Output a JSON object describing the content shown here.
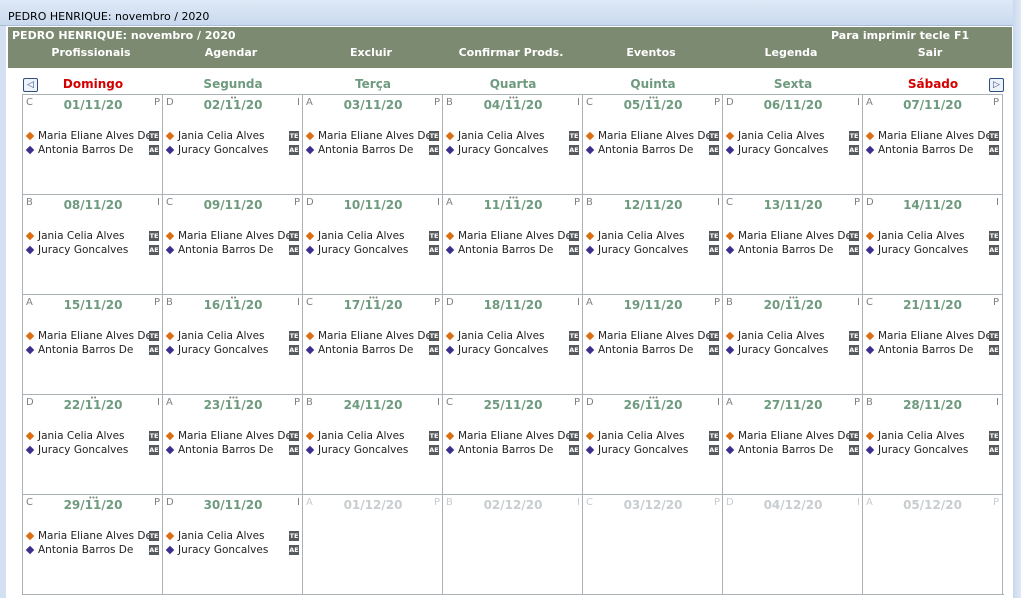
{
  "window": {
    "title": "PEDRO HENRIQUE: novembro / 2020"
  },
  "toolbar": {
    "title": "PEDRO HENRIQUE: novembro / 2020",
    "print_hint": "Para imprimir tecle F1",
    "menu": [
      "Profissionais",
      "Agendar",
      "Excluir",
      "Confirmar Prods.",
      "Eventos",
      "Legenda",
      "Sair"
    ]
  },
  "nav": {
    "prev_icon": "prev-month-icon",
    "next_icon": "next-month-icon"
  },
  "colors": {
    "toolbar_bg": "#7d8a72",
    "weekday": "#6e9a7e",
    "weekend": "#d40000",
    "marker_orange": "#d96f12",
    "marker_blue": "#3a2f8f"
  },
  "weekdays": [
    "Domingo",
    "Segunda",
    "Terça",
    "Quarta",
    "Quinta",
    "Sexta",
    "Sábado"
  ],
  "weeks": [
    [
      {
        "date": "01/11/20",
        "left": "C",
        "right": "P",
        "dots": "",
        "entries": [
          {
            "name": "Maria Eliane Alves De",
            "badge": "TE",
            "color": "orange"
          },
          {
            "name": "Antonia Barros De",
            "badge": "AE",
            "color": "blue"
          }
        ]
      },
      {
        "date": "02/11/20",
        "left": "D",
        "right": "I",
        "dots": "••",
        "entries": [
          {
            "name": "Jania Celia Alves",
            "badge": "TE",
            "color": "orange"
          },
          {
            "name": "Juracy Goncalves",
            "badge": "AE",
            "color": "blue"
          }
        ]
      },
      {
        "date": "03/11/20",
        "left": "A",
        "right": "P",
        "dots": "",
        "entries": [
          {
            "name": "Maria Eliane Alves De",
            "badge": "TE",
            "color": "orange"
          },
          {
            "name": "Antonia Barros De",
            "badge": "AE",
            "color": "blue"
          }
        ]
      },
      {
        "date": "04/11/20",
        "left": "B",
        "right": "I",
        "dots": "•••",
        "entries": [
          {
            "name": "Jania Celia Alves",
            "badge": "TE",
            "color": "orange"
          },
          {
            "name": "Juracy Goncalves",
            "badge": "AE",
            "color": "blue"
          }
        ]
      },
      {
        "date": "05/11/20",
        "left": "C",
        "right": "P",
        "dots": "•••",
        "entries": [
          {
            "name": "Maria Eliane Alves De",
            "badge": "TE",
            "color": "orange"
          },
          {
            "name": "Antonia Barros De",
            "badge": "AE",
            "color": "blue"
          }
        ]
      },
      {
        "date": "06/11/20",
        "left": "D",
        "right": "I",
        "dots": "",
        "entries": [
          {
            "name": "Jania Celia Alves",
            "badge": "TE",
            "color": "orange"
          },
          {
            "name": "Juracy Goncalves",
            "badge": "AE",
            "color": "blue"
          }
        ]
      },
      {
        "date": "07/11/20",
        "left": "A",
        "right": "P",
        "dots": "",
        "entries": [
          {
            "name": "Maria Eliane Alves De",
            "badge": "TE",
            "color": "orange"
          },
          {
            "name": "Antonia Barros De",
            "badge": "AE",
            "color": "blue"
          }
        ]
      }
    ],
    [
      {
        "date": "08/11/20",
        "left": "B",
        "right": "I",
        "dots": "",
        "entries": [
          {
            "name": "Jania Celia Alves",
            "badge": "TE",
            "color": "orange"
          },
          {
            "name": "Juracy Goncalves",
            "badge": "AE",
            "color": "blue"
          }
        ]
      },
      {
        "date": "09/11/20",
        "left": "C",
        "right": "P",
        "dots": "",
        "entries": [
          {
            "name": "Maria Eliane Alves De",
            "badge": "TE",
            "color": "orange"
          },
          {
            "name": "Antonia Barros De",
            "badge": "AE",
            "color": "blue"
          }
        ]
      },
      {
        "date": "10/11/20",
        "left": "D",
        "right": "I",
        "dots": "",
        "entries": [
          {
            "name": "Jania Celia Alves",
            "badge": "TE",
            "color": "orange"
          },
          {
            "name": "Juracy Goncalves",
            "badge": "AE",
            "color": "blue"
          }
        ]
      },
      {
        "date": "11/11/20",
        "left": "A",
        "right": "P",
        "dots": "•••",
        "entries": [
          {
            "name": "Maria Eliane Alves De",
            "badge": "TE",
            "color": "orange"
          },
          {
            "name": "Antonia Barros De",
            "badge": "AE",
            "color": "blue"
          }
        ]
      },
      {
        "date": "12/11/20",
        "left": "B",
        "right": "I",
        "dots": "",
        "entries": [
          {
            "name": "Jania Celia Alves",
            "badge": "TE",
            "color": "orange"
          },
          {
            "name": "Juracy Goncalves",
            "badge": "AE",
            "color": "blue"
          }
        ]
      },
      {
        "date": "13/11/20",
        "left": "C",
        "right": "P",
        "dots": "",
        "entries": [
          {
            "name": "Maria Eliane Alves De",
            "badge": "TE",
            "color": "orange"
          },
          {
            "name": "Antonia Barros De",
            "badge": "AE",
            "color": "blue"
          }
        ]
      },
      {
        "date": "14/11/20",
        "left": "D",
        "right": "I",
        "dots": "",
        "entries": [
          {
            "name": "Jania Celia Alves",
            "badge": "TE",
            "color": "orange"
          },
          {
            "name": "Juracy Goncalves",
            "badge": "AE",
            "color": "blue"
          }
        ]
      }
    ],
    [
      {
        "date": "15/11/20",
        "left": "A",
        "right": "P",
        "dots": "",
        "entries": [
          {
            "name": "Maria Eliane Alves De",
            "badge": "TE",
            "color": "orange"
          },
          {
            "name": "Antonia Barros De",
            "badge": "AE",
            "color": "blue"
          }
        ]
      },
      {
        "date": "16/11/20",
        "left": "B",
        "right": "I",
        "dots": "••",
        "entries": [
          {
            "name": "Jania Celia Alves",
            "badge": "TE",
            "color": "orange"
          },
          {
            "name": "Juracy Goncalves",
            "badge": "AE",
            "color": "blue"
          }
        ]
      },
      {
        "date": "17/11/20",
        "left": "C",
        "right": "P",
        "dots": "•••",
        "entries": [
          {
            "name": "Maria Eliane Alves De",
            "badge": "TE",
            "color": "orange"
          },
          {
            "name": "Antonia Barros De",
            "badge": "AE",
            "color": "blue"
          }
        ]
      },
      {
        "date": "18/11/20",
        "left": "D",
        "right": "I",
        "dots": "",
        "entries": [
          {
            "name": "Jania Celia Alves",
            "badge": "TE",
            "color": "orange"
          },
          {
            "name": "Juracy Goncalves",
            "badge": "AE",
            "color": "blue"
          }
        ]
      },
      {
        "date": "19/11/20",
        "left": "A",
        "right": "P",
        "dots": "",
        "entries": [
          {
            "name": "Maria Eliane Alves De",
            "badge": "TE",
            "color": "orange"
          },
          {
            "name": "Antonia Barros De",
            "badge": "AE",
            "color": "blue"
          }
        ]
      },
      {
        "date": "20/11/20",
        "left": "B",
        "right": "I",
        "dots": "•••",
        "entries": [
          {
            "name": "Jania Celia Alves",
            "badge": "TE",
            "color": "orange"
          },
          {
            "name": "Juracy Goncalves",
            "badge": "AE",
            "color": "blue"
          }
        ]
      },
      {
        "date": "21/11/20",
        "left": "C",
        "right": "P",
        "dots": "",
        "entries": [
          {
            "name": "Maria Eliane Alves De",
            "badge": "TE",
            "color": "orange"
          },
          {
            "name": "Antonia Barros De",
            "badge": "AE",
            "color": "blue"
          }
        ]
      }
    ],
    [
      {
        "date": "22/11/20",
        "left": "D",
        "right": "I",
        "dots": "••",
        "entries": [
          {
            "name": "Jania Celia Alves",
            "badge": "TE",
            "color": "orange"
          },
          {
            "name": "Juracy Goncalves",
            "badge": "AE",
            "color": "blue"
          }
        ]
      },
      {
        "date": "23/11/20",
        "left": "A",
        "right": "P",
        "dots": "•••",
        "entries": [
          {
            "name": "Maria Eliane Alves De",
            "badge": "TE",
            "color": "orange"
          },
          {
            "name": "Antonia Barros De",
            "badge": "AE",
            "color": "blue"
          }
        ]
      },
      {
        "date": "24/11/20",
        "left": "B",
        "right": "I",
        "dots": "",
        "entries": [
          {
            "name": "Jania Celia Alves",
            "badge": "TE",
            "color": "orange"
          },
          {
            "name": "Juracy Goncalves",
            "badge": "AE",
            "color": "blue"
          }
        ]
      },
      {
        "date": "25/11/20",
        "left": "C",
        "right": "P",
        "dots": "",
        "entries": [
          {
            "name": "Maria Eliane Alves De",
            "badge": "TE",
            "color": "orange"
          },
          {
            "name": "Antonia Barros De",
            "badge": "AE",
            "color": "blue"
          }
        ]
      },
      {
        "date": "26/11/20",
        "left": "D",
        "right": "I",
        "dots": "•••",
        "entries": [
          {
            "name": "Jania Celia Alves",
            "badge": "TE",
            "color": "orange"
          },
          {
            "name": "Juracy Goncalves",
            "badge": "AE",
            "color": "blue"
          }
        ]
      },
      {
        "date": "27/11/20",
        "left": "A",
        "right": "P",
        "dots": "",
        "entries": [
          {
            "name": "Maria Eliane Alves De",
            "badge": "TE",
            "color": "orange"
          },
          {
            "name": "Antonia Barros De",
            "badge": "AE",
            "color": "blue"
          }
        ]
      },
      {
        "date": "28/11/20",
        "left": "B",
        "right": "I",
        "dots": "",
        "entries": [
          {
            "name": "Jania Celia Alves",
            "badge": "TE",
            "color": "orange"
          },
          {
            "name": "Juracy Goncalves",
            "badge": "AE",
            "color": "blue"
          }
        ]
      }
    ],
    [
      {
        "date": "29/11/20",
        "left": "C",
        "right": "P",
        "dots": "•••",
        "entries": [
          {
            "name": "Maria Eliane Alves De",
            "badge": "TE",
            "color": "orange"
          },
          {
            "name": "Antonia Barros De",
            "badge": "AE",
            "color": "blue"
          }
        ]
      },
      {
        "date": "30/11/20",
        "left": "D",
        "right": "I",
        "dots": "",
        "entries": [
          {
            "name": "Jania Celia Alves",
            "badge": "TE",
            "color": "orange"
          },
          {
            "name": "Juracy Goncalves",
            "badge": "AE",
            "color": "blue"
          }
        ]
      },
      {
        "date": "01/12/20",
        "left": "A",
        "right": "P",
        "dots": "",
        "other": true,
        "entries": []
      },
      {
        "date": "02/12/20",
        "left": "B",
        "right": "I",
        "dots": "",
        "other": true,
        "entries": []
      },
      {
        "date": "03/12/20",
        "left": "C",
        "right": "P",
        "dots": "",
        "other": true,
        "entries": []
      },
      {
        "date": "04/12/20",
        "left": "D",
        "right": "I",
        "dots": "",
        "other": true,
        "entries": []
      },
      {
        "date": "05/12/20",
        "left": "A",
        "right": "P",
        "dots": "",
        "other": true,
        "entries": []
      }
    ]
  ]
}
